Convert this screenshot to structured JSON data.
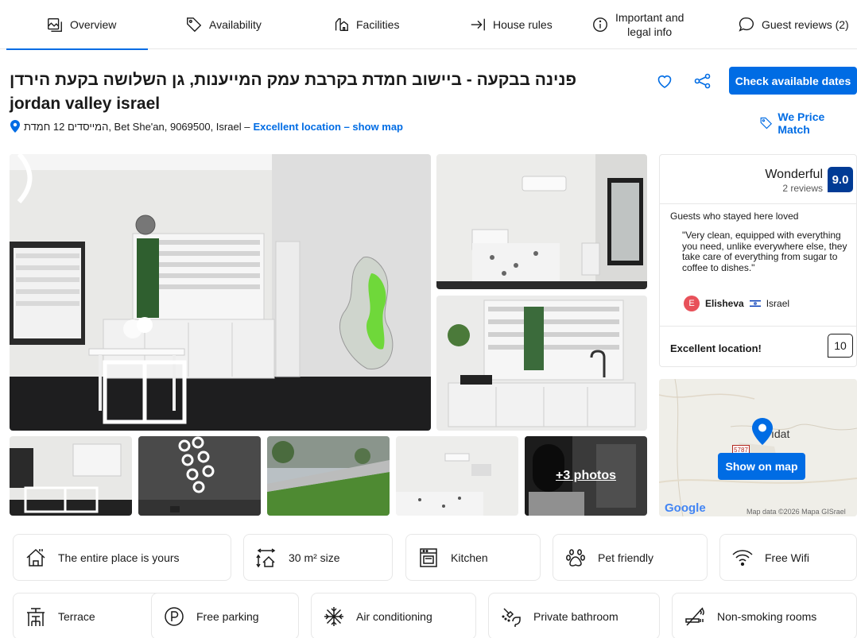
{
  "tabs": [
    {
      "label": "Overview",
      "icon": "overview-icon"
    },
    {
      "label": "Availability",
      "icon": "tag-icon"
    },
    {
      "label": "Facilities",
      "icon": "bell-icon"
    },
    {
      "label": "House rules",
      "icon": "arrow-right-icon"
    },
    {
      "label": "Important and",
      "label2": "legal info",
      "icon": "info-icon"
    },
    {
      "label": "Guest reviews (2)",
      "icon": "speech-bubble-icon"
    }
  ],
  "property": {
    "title_line1": "פנינה בבקעה - ביישוב חמדת בקרבת עמק המייענות, גן השלושה בקעת הירדן",
    "title_line2": "jordan valley israel",
    "address": "המייסדים 12 חמדת, Bet She'an, 9069500, Israel –",
    "location_link": "Excellent location – show map"
  },
  "actions": {
    "check_dates": "Check available dates",
    "price_match": "We Price Match"
  },
  "gallery": {
    "more_photos": "+3 photos"
  },
  "review": {
    "rating_word": "Wonderful",
    "review_count": "2 reviews",
    "score": "9.0",
    "loved_heading": "Guests who stayed here loved",
    "quote": "\"Very clean, equipped with everything you need, unlike everywhere else, they take care of everything from sugar to coffee to dishes.\"",
    "reviewer_initial": "E",
    "reviewer_name": "Elisheva",
    "reviewer_country": "Israel",
    "location_label": "Excellent location!",
    "location_score": "10"
  },
  "map": {
    "button": "Show on map",
    "town_label": "ıdat",
    "road_number": "5787",
    "logo_text": "Google",
    "attribution": "Map data ©2026 Mapa GISrael"
  },
  "facilities_row1": [
    {
      "label": "The entire place is yours",
      "icon": "house-icon"
    },
    {
      "label": "30 m² size",
      "icon": "size-icon"
    },
    {
      "label": "Kitchen",
      "icon": "kitchen-icon"
    },
    {
      "label": "Pet friendly",
      "icon": "paw-icon"
    },
    {
      "label": "Free Wifi",
      "icon": "wifi-icon"
    }
  ],
  "facilities_row2": [
    {
      "label": "Terrace",
      "icon": "terrace-icon"
    },
    {
      "label": "Free parking",
      "icon": "parking-icon"
    },
    {
      "label": "Air conditioning",
      "icon": "snowflake-icon"
    },
    {
      "label": "Private bathroom",
      "icon": "shower-icon"
    },
    {
      "label": "Non-smoking rooms",
      "icon": "no-smoking-icon"
    }
  ],
  "colors": {
    "brand_blue": "#006ce4",
    "score_blue": "#003b95",
    "avatar_red": "#e8515a"
  }
}
